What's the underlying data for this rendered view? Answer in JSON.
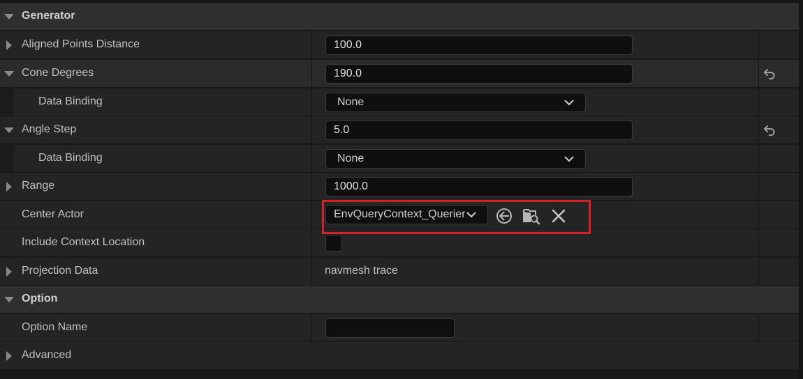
{
  "categories": {
    "generator": "Generator",
    "option": "Option"
  },
  "rows": {
    "aligned_points_distance": {
      "label": "Aligned Points Distance",
      "value": "100.0"
    },
    "cone_degrees": {
      "label": "Cone Degrees",
      "value": "190.0"
    },
    "cone_data_binding": {
      "label": "Data Binding",
      "value": "None"
    },
    "angle_step": {
      "label": "Angle Step",
      "value": "5.0"
    },
    "angle_data_binding": {
      "label": "Data Binding",
      "value": "None"
    },
    "range": {
      "label": "Range",
      "value": "1000.0"
    },
    "center_actor": {
      "label": "Center Actor",
      "value": "EnvQueryContext_Querier"
    },
    "include_context_location": {
      "label": "Include Context Location",
      "checked": false
    },
    "projection_data": {
      "label": "Projection Data",
      "value": "navmesh trace"
    },
    "option_name": {
      "label": "Option Name",
      "value": ""
    },
    "advanced": {
      "label": "Advanced"
    }
  },
  "icons": {
    "reset": "reset-to-default-icon",
    "use_selected": "use-selected-icon",
    "browse": "browse-asset-icon",
    "clear": "clear-icon",
    "expand": "expand-arrow-icon",
    "collapse": "collapse-arrow-icon",
    "dropdown": "chevron-down-icon"
  },
  "colors": {
    "highlight": "#d8202a",
    "panel_bg": "#242424",
    "category_bg": "#2f2f2f"
  }
}
